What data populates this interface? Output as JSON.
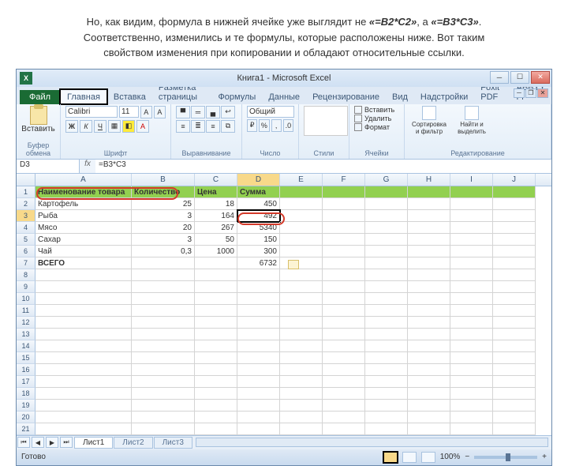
{
  "caption": {
    "pre": "Но, как видим, формула в нижней ячейке уже выглядит не ",
    "f1": "«=B2*C2»",
    "mid": ", а ",
    "f2": "«=B3*C3»",
    "post": ". Соответственно, изменились и те формулы, которые расположены ниже. Вот таким свойством изменения при копировании и обладают относительные ссылки."
  },
  "app": {
    "title": "Книга1 - Microsoft Excel",
    "icon_letter": "X"
  },
  "tabs": {
    "file": "Файл",
    "list": [
      "Главная",
      "Вставка",
      "Разметка страницы",
      "Формулы",
      "Данные",
      "Рецензирование",
      "Вид",
      "Надстройки",
      "Foxit PDF",
      "ABBYY Fi"
    ]
  },
  "ribbon": {
    "paste": "Вставить",
    "clipboard": "Буфер обмена",
    "font_name": "Calibri",
    "font_size": "11",
    "font_label": "Шрифт",
    "align_label": "Выравнивание",
    "num_format": "Общий",
    "num_label": "Число",
    "styles_label": "Стили",
    "cells_insert": "Вставить",
    "cells_delete": "Удалить",
    "cells_format": "Формат",
    "cells_label": "Ячейки",
    "sort": "Сортировка и фильтр",
    "find": "Найти и выделить",
    "edit_label": "Редактирование"
  },
  "namebox": "D3",
  "formula": "=B3*C3",
  "fx": "fx",
  "columns": [
    "A",
    "B",
    "C",
    "D",
    "E",
    "F",
    "G",
    "H",
    "I",
    "J"
  ],
  "headers": {
    "A": "Наименование товара",
    "B": "Количество",
    "C": "Цена",
    "D": "Сумма"
  },
  "data_rows": [
    {
      "n": "2",
      "A": "Картофель",
      "B": "25",
      "C": "18",
      "D": "450"
    },
    {
      "n": "3",
      "A": "Рыба",
      "B": "3",
      "C": "164",
      "D": "492"
    },
    {
      "n": "4",
      "A": "Мясо",
      "B": "20",
      "C": "267",
      "D": "5340"
    },
    {
      "n": "5",
      "A": "Сахар",
      "B": "3",
      "C": "50",
      "D": "150"
    },
    {
      "n": "6",
      "A": "Чай",
      "B": "0,3",
      "C": "1000",
      "D": "300"
    }
  ],
  "total": {
    "n": "7",
    "A": "ВСЕГО",
    "D": "6732"
  },
  "empty_rows": [
    "8",
    "9",
    "10",
    "11",
    "12",
    "13",
    "14",
    "15",
    "16",
    "17",
    "18",
    "19",
    "20",
    "21"
  ],
  "sheets": {
    "s1": "Лист1",
    "s2": "Лист2",
    "s3": "Лист3"
  },
  "status": {
    "ready": "Готово",
    "zoom": "100%",
    "minus": "−",
    "plus": "+"
  }
}
